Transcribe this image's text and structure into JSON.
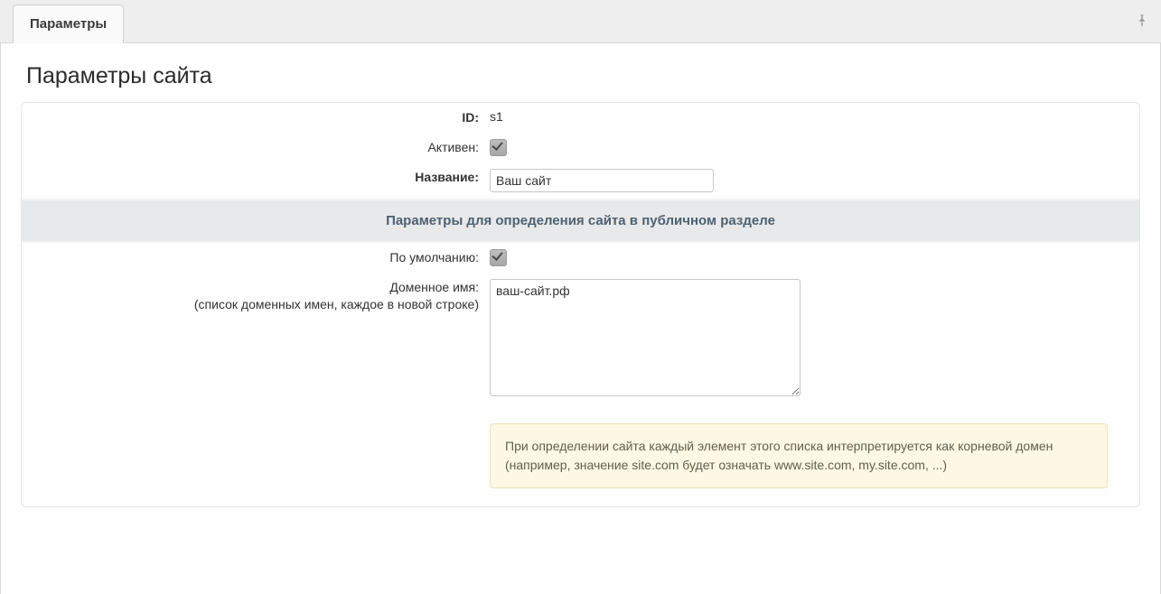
{
  "tab": {
    "label": "Параметры"
  },
  "page": {
    "title": "Параметры сайта"
  },
  "form": {
    "id_label": "ID:",
    "id_value": "s1",
    "active_label": "Активен:",
    "active_checked": true,
    "name_label": "Название:",
    "name_value": "Ваш сайт",
    "section_heading": "Параметры для определения сайта в публичном разделе",
    "default_label": "По умолчанию:",
    "default_checked": true,
    "domain_label": "Доменное имя:",
    "domain_sublabel": "(список доменных имен, каждое в новой строке)",
    "domain_value": "ваш-сайт.рф",
    "domain_hint": "При определении сайта каждый элемент этого списка интерпретируется как корневой домен (например, значение site.com будет означать www.site.com, my.site.com, ...)"
  }
}
